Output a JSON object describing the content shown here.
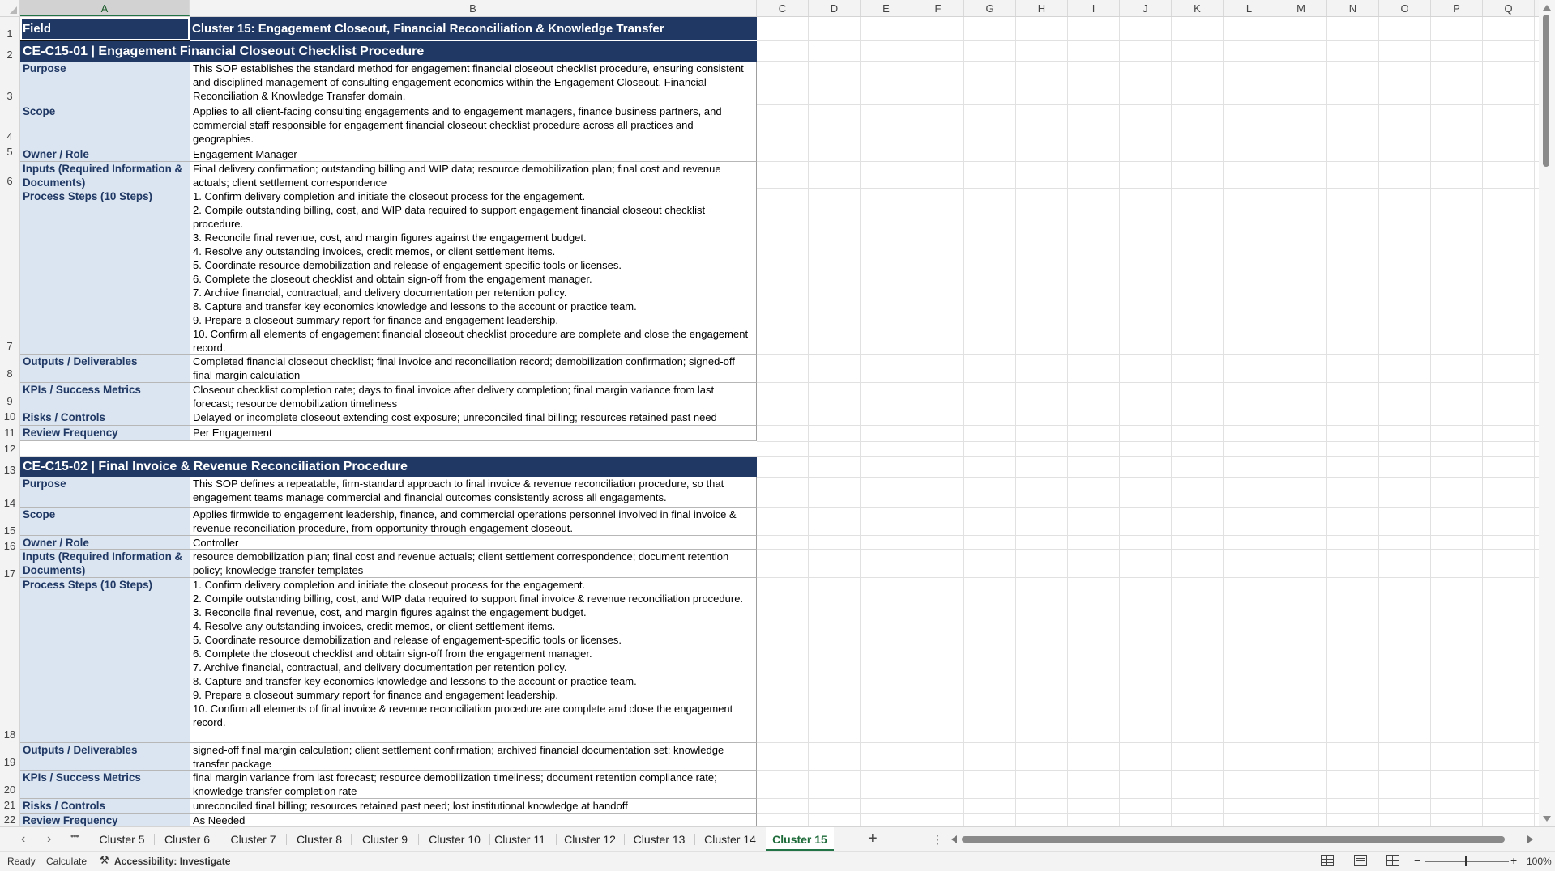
{
  "columns": [
    "A",
    "B",
    "C",
    "D",
    "E",
    "F",
    "G",
    "H",
    "I",
    "J",
    "K",
    "L",
    "M",
    "N",
    "O",
    "P",
    "Q"
  ],
  "row_numbers": [
    "1",
    "2",
    "3",
    "4",
    "5",
    "6",
    "7",
    "8",
    "9",
    "10",
    "11",
    "12",
    "13",
    "14",
    "15",
    "16",
    "17",
    "18",
    "19",
    "20",
    "21",
    "22"
  ],
  "header": {
    "field": "Field",
    "cluster_title": "Cluster 15: Engagement Closeout, Financial Reconciliation & Knowledge Transfer"
  },
  "section1": {
    "title": "CE-C15-01  |  Engagement Financial Closeout Checklist Procedure",
    "purpose_label": "Purpose",
    "purpose": "This SOP establishes the standard method for engagement financial closeout checklist procedure, ensuring consistent and disciplined management of consulting engagement economics within the Engagement Closeout, Financial Reconciliation & Knowledge Transfer domain.",
    "scope_label": "Scope",
    "scope": "Applies to all client-facing consulting engagements and to engagement managers, finance business partners, and commercial staff responsible for engagement financial closeout checklist procedure across all practices and geographies.",
    "owner_label": "Owner / Role",
    "owner": "Engagement Manager",
    "inputs_label": "Inputs (Required Information & Documents)",
    "inputs": "Final delivery confirmation; outstanding billing and WIP data; resource demobilization plan; final cost and revenue actuals; client settlement correspondence",
    "steps_label": "Process Steps (10 Steps)",
    "steps": "1. Confirm delivery completion and initiate the closeout process for the engagement.\n2. Compile outstanding billing, cost, and WIP data required to support engagement financial closeout checklist procedure.\n3. Reconcile final revenue, cost, and margin figures against the engagement budget.\n4. Resolve any outstanding invoices, credit memos, or client settlement items.\n5. Coordinate resource demobilization and release of engagement-specific tools or licenses.\n6. Complete the closeout checklist and obtain sign-off from the engagement manager.\n7. Archive financial, contractual, and delivery documentation per retention policy.\n8. Capture and transfer key economics knowledge and lessons to the account or practice team.\n9. Prepare a closeout summary report for finance and engagement leadership.\n10. Confirm all elements of engagement financial closeout checklist procedure are complete and close the engagement record.",
    "outputs_label": "Outputs / Deliverables",
    "outputs": "Completed financial closeout checklist; final invoice and reconciliation record; demobilization confirmation; signed-off final margin calculation",
    "kpis_label": "KPIs / Success Metrics",
    "kpis": "Closeout checklist completion rate; days to final invoice after delivery completion; final margin variance from last forecast; resource demobilization timeliness",
    "risks_label": "Risks / Controls",
    "risks": "Delayed or incomplete closeout extending cost exposure; unreconciled final billing; resources retained past need",
    "review_label": "Review Frequency",
    "review": "Per Engagement"
  },
  "section2": {
    "title": "CE-C15-02  |  Final Invoice & Revenue Reconciliation Procedure",
    "purpose_label": "Purpose",
    "purpose": "This SOP defines a repeatable, firm-standard approach to final invoice & revenue reconciliation procedure, so that engagement teams manage commercial and financial outcomes consistently across all engagements.",
    "scope_label": "Scope",
    "scope": "Applies firmwide to engagement leadership, finance, and commercial operations personnel involved in final invoice & revenue reconciliation procedure, from opportunity through engagement closeout.",
    "owner_label": "Owner / Role",
    "owner": "Controller",
    "inputs_label": "Inputs (Required Information & Documents)",
    "inputs": "resource demobilization plan; final cost and revenue actuals; client settlement correspondence; document retention policy; knowledge transfer templates",
    "steps_label": "Process Steps (10 Steps)",
    "steps": "1. Confirm delivery completion and initiate the closeout process for the engagement.\n2. Compile outstanding billing, cost, and WIP data required to support final invoice & revenue reconciliation procedure.\n3. Reconcile final revenue, cost, and margin figures against the engagement budget.\n4. Resolve any outstanding invoices, credit memos, or client settlement items.\n5. Coordinate resource demobilization and release of engagement-specific tools or licenses.\n6. Complete the closeout checklist and obtain sign-off from the engagement manager.\n7. Archive financial, contractual, and delivery documentation per retention policy.\n8. Capture and transfer key economics knowledge and lessons to the account or practice team.\n9. Prepare a closeout summary report for finance and engagement leadership.\n10. Confirm all elements of final invoice & revenue reconciliation procedure are complete and close the engagement record.",
    "outputs_label": "Outputs / Deliverables",
    "outputs": "signed-off final margin calculation; client settlement confirmation; archived financial documentation set; knowledge transfer package",
    "kpis_label": "KPIs / Success Metrics",
    "kpis": "final margin variance from last forecast; resource demobilization timeliness; document retention compliance rate; knowledge transfer completion rate",
    "risks_label": "Risks / Controls",
    "risks": "unreconciled final billing; resources retained past need; lost institutional knowledge at handoff",
    "review_label": "Review Frequency",
    "review": "As Needed"
  },
  "sheet_tabs": [
    "Cluster 5",
    "Cluster 6",
    "Cluster 7",
    "Cluster 8",
    "Cluster 9",
    "Cluster 10",
    "Cluster 11",
    "Cluster 12",
    "Cluster 13",
    "Cluster 14",
    "Cluster 15"
  ],
  "active_tab": "Cluster 15",
  "tab_controls": {
    "more": "•••",
    "add": "+",
    "options": "⋮"
  },
  "status": {
    "ready": "Ready",
    "calculate": "Calculate",
    "accessibility": "Accessibility: Investigate",
    "zoom": "100%",
    "zoom_minus": "−",
    "zoom_plus": "+"
  }
}
